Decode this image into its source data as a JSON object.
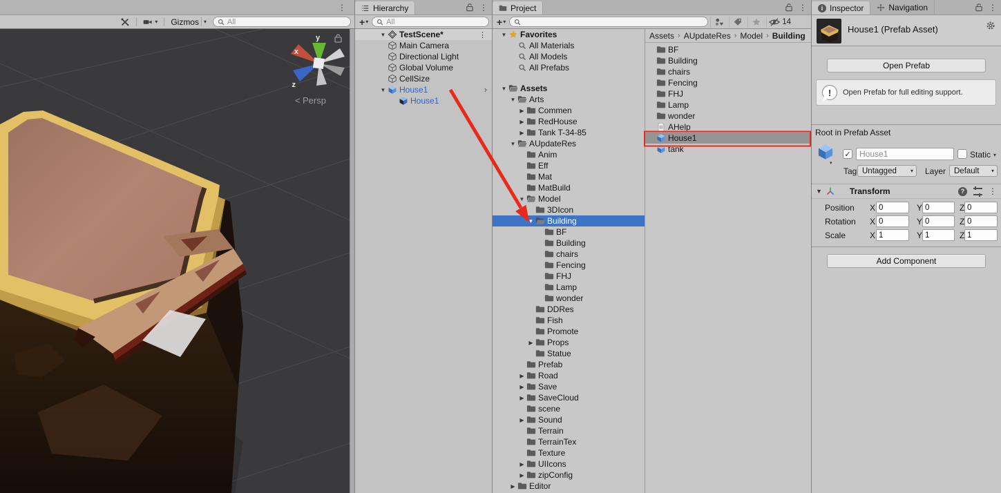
{
  "annotations": {
    "color": "#e82a1d"
  },
  "scene_view": {
    "toolbar": {
      "gizmos_label": "Gizmos",
      "search_placeholder": "All"
    },
    "gizmo": {
      "x_label": "x",
      "y_label": "y",
      "z_label": "z",
      "persp_prefix": "<",
      "persp_label": "Persp"
    }
  },
  "hierarchy": {
    "tab_title": "Hierarchy",
    "create_label": "+",
    "search_placeholder": "All",
    "scene_name": "TestScene*",
    "items": [
      {
        "label": "Main Camera",
        "icon": "gameobject",
        "level": 1
      },
      {
        "label": "Directional Light",
        "icon": "gameobject",
        "level": 1
      },
      {
        "label": "Global Volume",
        "icon": "gameobject",
        "level": 1
      },
      {
        "label": "CellSize",
        "icon": "gameobject",
        "level": 1
      },
      {
        "label": "House1",
        "icon": "prefab",
        "level": 1,
        "expanded": true,
        "blue": true,
        "nav_arrow": true
      },
      {
        "label": "House1",
        "icon": "prefab-model",
        "level": 2,
        "blue": true
      }
    ]
  },
  "project": {
    "tab_title": "Project",
    "create_label": "+",
    "search_placeholder": "",
    "hidden_count": "14",
    "favorites": {
      "label": "Favorites",
      "items": [
        {
          "label": "All Materials"
        },
        {
          "label": "All Models"
        },
        {
          "label": "All Prefabs"
        }
      ]
    },
    "tree": [
      {
        "label": "Assets",
        "level": 0,
        "state": "expanded",
        "open": true,
        "bold": true
      },
      {
        "label": "Arts",
        "level": 1,
        "state": "expanded",
        "open": true
      },
      {
        "label": "Commen",
        "level": 2,
        "state": "collapsed"
      },
      {
        "label": "RedHouse",
        "level": 2,
        "state": "collapsed"
      },
      {
        "label": "Tank T-34-85",
        "level": 2,
        "state": "collapsed"
      },
      {
        "label": "AUpdateRes",
        "level": 1,
        "state": "expanded",
        "open": true
      },
      {
        "label": "Anim",
        "level": 2,
        "state": "leaf"
      },
      {
        "label": "Eff",
        "level": 2,
        "state": "leaf"
      },
      {
        "label": "Mat",
        "level": 2,
        "state": "leaf"
      },
      {
        "label": "MatBuild",
        "level": 2,
        "state": "leaf"
      },
      {
        "label": "Model",
        "level": 2,
        "state": "expanded",
        "open": true
      },
      {
        "label": "3DIcon",
        "level": 3,
        "state": "leaf"
      },
      {
        "label": "Building",
        "level": 3,
        "state": "expanded",
        "open": true,
        "selected": true
      },
      {
        "label": "BF",
        "level": 4,
        "state": "leaf"
      },
      {
        "label": "Building",
        "level": 4,
        "state": "leaf"
      },
      {
        "label": "chairs",
        "level": 4,
        "state": "leaf"
      },
      {
        "label": "Fencing",
        "level": 4,
        "state": "leaf"
      },
      {
        "label": "FHJ",
        "level": 4,
        "state": "leaf"
      },
      {
        "label": "Lamp",
        "level": 4,
        "state": "leaf"
      },
      {
        "label": "wonder",
        "level": 4,
        "state": "leaf"
      },
      {
        "label": "DDRes",
        "level": 3,
        "state": "leaf"
      },
      {
        "label": "Fish",
        "level": 3,
        "state": "leaf"
      },
      {
        "label": "Promote",
        "level": 3,
        "state": "leaf"
      },
      {
        "label": "Props",
        "level": 3,
        "state": "collapsed"
      },
      {
        "label": "Statue",
        "level": 3,
        "state": "leaf"
      },
      {
        "label": "Prefab",
        "level": 2,
        "state": "leaf"
      },
      {
        "label": "Road",
        "level": 2,
        "state": "collapsed"
      },
      {
        "label": "Save",
        "level": 2,
        "state": "collapsed"
      },
      {
        "label": "SaveCloud",
        "level": 2,
        "state": "collapsed"
      },
      {
        "label": "scene",
        "level": 2,
        "state": "leaf"
      },
      {
        "label": "Sound",
        "level": 2,
        "state": "collapsed"
      },
      {
        "label": "Terrain",
        "level": 2,
        "state": "leaf"
      },
      {
        "label": "TerrainTex",
        "level": 2,
        "state": "leaf"
      },
      {
        "label": "Texture",
        "level": 2,
        "state": "leaf"
      },
      {
        "label": "UIIcons",
        "level": 2,
        "state": "collapsed"
      },
      {
        "label": "zipConfig",
        "level": 2,
        "state": "collapsed"
      },
      {
        "label": "Editor",
        "level": 1,
        "state": "collapsed"
      }
    ],
    "breadcrumbs": [
      "Assets",
      "AUpdateRes",
      "Model",
      "Building"
    ],
    "files": [
      {
        "label": "BF",
        "icon": "folder"
      },
      {
        "label": "Building",
        "icon": "folder"
      },
      {
        "label": "chairs",
        "icon": "folder"
      },
      {
        "label": "Fencing",
        "icon": "folder"
      },
      {
        "label": "FHJ",
        "icon": "folder"
      },
      {
        "label": "Lamp",
        "icon": "folder"
      },
      {
        "label": "wonder",
        "icon": "folder"
      },
      {
        "label": "AHelp",
        "icon": "doc"
      },
      {
        "label": "House1",
        "icon": "prefab",
        "selected": true
      },
      {
        "label": "tank",
        "icon": "prefab"
      }
    ]
  },
  "inspector": {
    "tab_inspector": "Inspector",
    "tab_navigation": "Navigation",
    "title": "House1 (Prefab Asset)",
    "open_prefab_label": "Open Prefab",
    "help_text": "Open Prefab for full editing support.",
    "root_label": "Root in Prefab Asset",
    "name_value": "House1",
    "static_label": "Static",
    "tag_label": "Tag",
    "tag_value": "Untagged",
    "layer_label": "Layer",
    "layer_value": "Default",
    "transform": {
      "title": "Transform",
      "axis_labels": [
        "X",
        "Y",
        "Z"
      ],
      "rows": [
        {
          "label": "Position",
          "x": "0",
          "y": "0",
          "z": "0"
        },
        {
          "label": "Rotation",
          "x": "0",
          "y": "0",
          "z": "0"
        },
        {
          "label": "Scale",
          "x": "1",
          "y": "1",
          "z": "1"
        }
      ]
    },
    "add_component_label": "Add Component"
  }
}
